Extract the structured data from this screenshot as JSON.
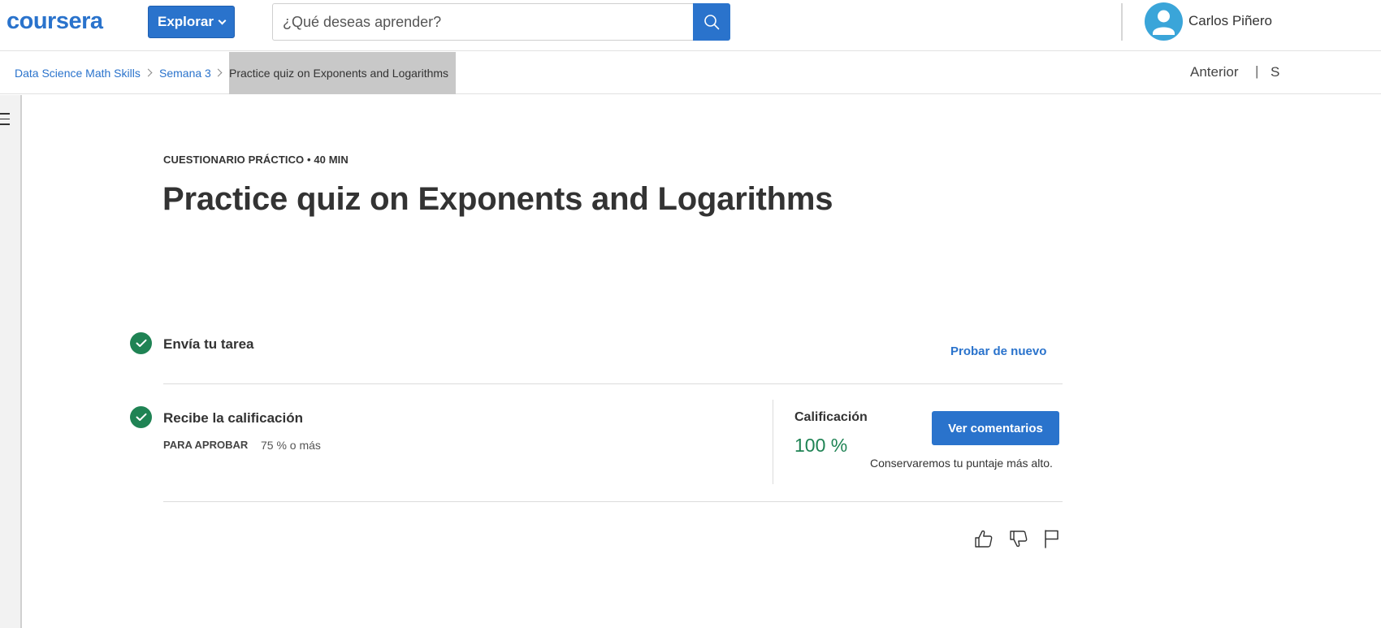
{
  "header": {
    "logo": "coursera",
    "explore_label": "Explorar",
    "search": {
      "placeholder": "¿Qué deseas aprender?",
      "value": ""
    },
    "user_name": "Carlos Piñero"
  },
  "breadcrumb": {
    "items": [
      {
        "label": "Data Science Math Skills"
      },
      {
        "label": "Semana 3"
      }
    ],
    "current": "Practice quiz on Exponents and Logarithms"
  },
  "nav": {
    "previous": "Anterior",
    "separator": "|",
    "next": "S"
  },
  "item": {
    "type_label": "CUESTIONARIO PRÁCTICO • 40 MIN",
    "title": "Practice quiz on Exponents and Logarithms"
  },
  "steps": [
    {
      "title": "Envía tu tarea",
      "action": "Probar de nuevo"
    },
    {
      "title": "Recibe la calificación",
      "pass_label": "PARA APROBAR",
      "pass_value": "75 % o más"
    }
  ],
  "grade": {
    "label": "Calificación",
    "value": "100 %",
    "feedback_button": "Ver comentarios",
    "note": "Conservaremos tu puntaje más alto."
  },
  "colors": {
    "brand": "#2a73cc",
    "success": "#1f8354",
    "current_crumb_bg": "#c8c8c8"
  },
  "icons": [
    "search-icon",
    "chevron-down-icon",
    "user-icon",
    "menu-icon",
    "check-icon",
    "thumbs-up-icon",
    "thumbs-down-icon",
    "flag-icon"
  ]
}
